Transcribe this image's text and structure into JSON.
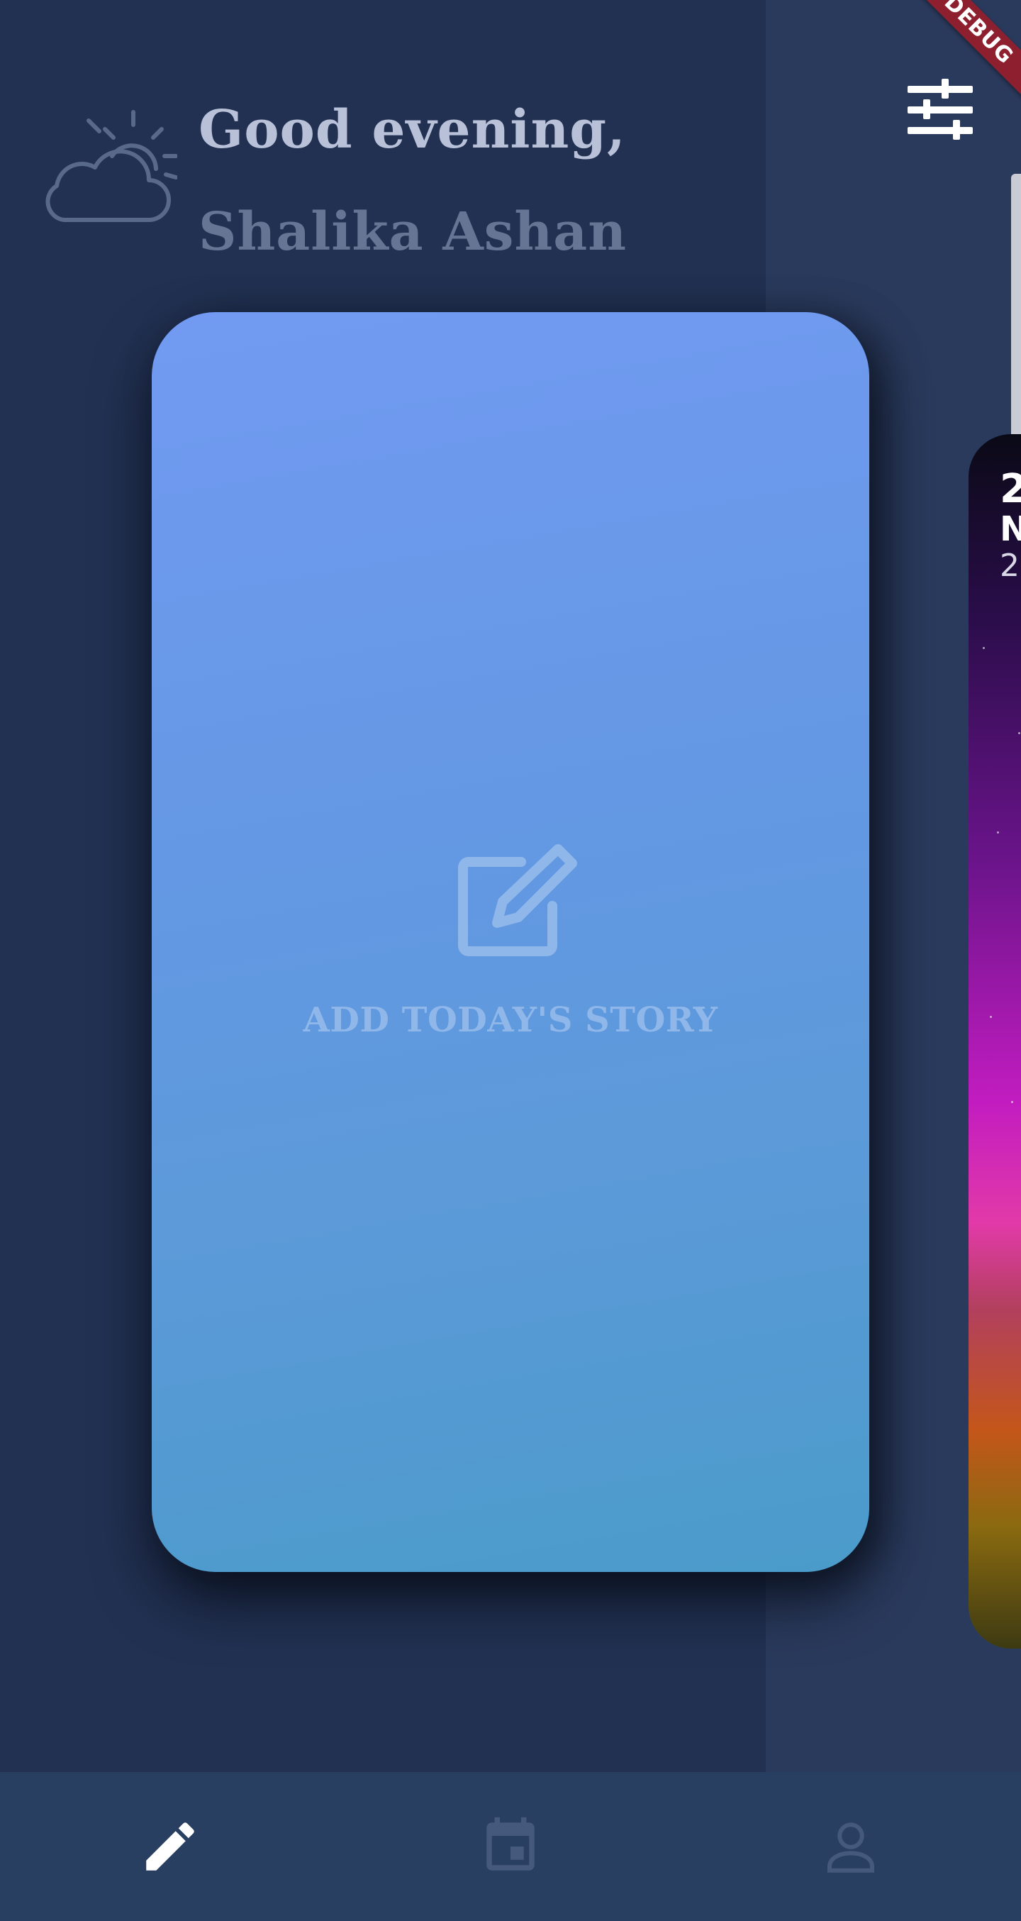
{
  "debug_banner": "DEBUG",
  "header": {
    "greeting": "Good evening,",
    "user_name": "Shalika Ashan",
    "weather_icon": "cloud-sun-icon",
    "filter_icon": "sliders-icon"
  },
  "story_card": {
    "label": "ADD TODAY'S STORY",
    "icon": "edit-icon"
  },
  "next_card": {
    "day": "2",
    "month": "N",
    "year": "2"
  },
  "bottom_nav": {
    "items": [
      {
        "icon": "pencil-icon",
        "active": true
      },
      {
        "icon": "calendar-icon",
        "active": false
      },
      {
        "icon": "profile-icon",
        "active": false
      }
    ]
  },
  "colors": {
    "background": "#223152",
    "side_panel": "#2a3a5c",
    "card_top": "#729af2",
    "card_bottom": "#4a9bca",
    "nav_bar": "#283f61"
  }
}
